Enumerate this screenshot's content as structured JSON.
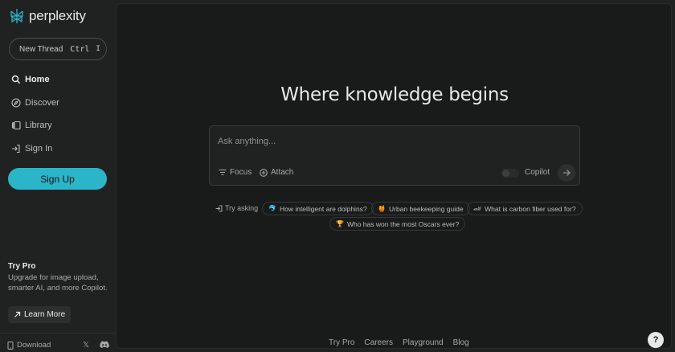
{
  "brand": {
    "name": "perplexity",
    "accent": "#2bb5c9"
  },
  "sidebar": {
    "new_thread": {
      "label": "New Thread",
      "kbd": "Ctrl",
      "kbd_key": "I"
    },
    "items": [
      {
        "label": "Home",
        "icon": "search-icon",
        "active": true
      },
      {
        "label": "Discover",
        "icon": "compass-icon"
      },
      {
        "label": "Library",
        "icon": "library-icon"
      },
      {
        "label": "Sign In",
        "icon": "sign-in-icon"
      }
    ],
    "signup_label": "Sign Up",
    "try_pro": {
      "title": "Try Pro",
      "description": "Upgrade for image upload, smarter AI, and more Copilot.",
      "learn_more": "Learn More"
    },
    "footer": {
      "download": "Download"
    }
  },
  "main": {
    "headline": "Where knowledge begins",
    "search": {
      "placeholder": "Ask anything...",
      "focus_label": "Focus",
      "attach_label": "Attach",
      "copilot_label": "Copilot"
    },
    "try_asking": "Try asking",
    "suggestions": [
      {
        "label": "How intelligent are dolphins?",
        "icon": "dolphin-icon"
      },
      {
        "label": "Urban beekeeping guide",
        "icon": "beehive-icon"
      },
      {
        "label": "What is carbon fiber used for?",
        "icon": "carbon-fiber-icon"
      },
      {
        "label": "Who has won the most Oscars ever?",
        "icon": "trophy-icon"
      }
    ],
    "footer_links": [
      "Try Pro",
      "Careers",
      "Playground",
      "Blog"
    ],
    "help_label": "?"
  }
}
